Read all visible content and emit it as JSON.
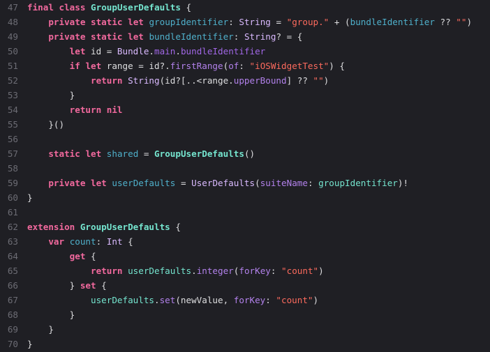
{
  "editor": {
    "colors": {
      "background": "#1f1f24",
      "line_number": "#6c6c74",
      "keyword": "#f2699e",
      "type": "#dabaff",
      "class_name": "#75e5cf",
      "property": "#a167e6",
      "variable": "#4fb0cb",
      "string": "#fc6a5d",
      "plain": "#dedee0"
    },
    "lines": [
      {
        "num": "47",
        "tokens": [
          [
            "final",
            "kw"
          ],
          [
            " ",
            "plain"
          ],
          [
            "class",
            "kw"
          ],
          [
            " ",
            "plain"
          ],
          [
            "GroupUserDefaults",
            "cls"
          ],
          [
            " {",
            "plain"
          ]
        ]
      },
      {
        "num": "48",
        "tokens": [
          [
            "    ",
            "plain"
          ],
          [
            "private",
            "kw"
          ],
          [
            " ",
            "plain"
          ],
          [
            "static",
            "kw"
          ],
          [
            " ",
            "plain"
          ],
          [
            "let",
            "kw"
          ],
          [
            " ",
            "plain"
          ],
          [
            "groupIdentifier",
            "var"
          ],
          [
            ": ",
            "plain"
          ],
          [
            "String",
            "type"
          ],
          [
            " = ",
            "plain"
          ],
          [
            "\"group.\"",
            "str"
          ],
          [
            " + (",
            "plain"
          ],
          [
            "bundleIdentifier",
            "var"
          ],
          [
            " ?? ",
            "plain"
          ],
          [
            "\"\"",
            "str"
          ],
          [
            ")",
            "plain"
          ]
        ]
      },
      {
        "num": "49",
        "tokens": [
          [
            "    ",
            "plain"
          ],
          [
            "private",
            "kw"
          ],
          [
            " ",
            "plain"
          ],
          [
            "static",
            "kw"
          ],
          [
            " ",
            "plain"
          ],
          [
            "let",
            "kw"
          ],
          [
            " ",
            "plain"
          ],
          [
            "bundleIdentifier",
            "var"
          ],
          [
            ": ",
            "plain"
          ],
          [
            "String",
            "type"
          ],
          [
            "? = {",
            "plain"
          ]
        ]
      },
      {
        "num": "50",
        "tokens": [
          [
            "        ",
            "plain"
          ],
          [
            "let",
            "kw"
          ],
          [
            " id = ",
            "plain"
          ],
          [
            "Bundle",
            "type"
          ],
          [
            ".",
            "plain"
          ],
          [
            "main",
            "prop"
          ],
          [
            ".",
            "plain"
          ],
          [
            "bundleIdentifier",
            "prop"
          ]
        ]
      },
      {
        "num": "51",
        "tokens": [
          [
            "        ",
            "plain"
          ],
          [
            "if",
            "kw"
          ],
          [
            " ",
            "plain"
          ],
          [
            "let",
            "kw"
          ],
          [
            " range = id?.",
            "plain"
          ],
          [
            "firstRange",
            "lib"
          ],
          [
            "(",
            "plain"
          ],
          [
            "of",
            "lib"
          ],
          [
            ": ",
            "plain"
          ],
          [
            "\"iOSWidgetTest\"",
            "str"
          ],
          [
            ") {",
            "plain"
          ]
        ]
      },
      {
        "num": "52",
        "tokens": [
          [
            "            ",
            "plain"
          ],
          [
            "return",
            "kw"
          ],
          [
            " ",
            "plain"
          ],
          [
            "String",
            "type"
          ],
          [
            "(id?[..<range.",
            "plain"
          ],
          [
            "upperBound",
            "lib"
          ],
          [
            "] ?? ",
            "plain"
          ],
          [
            "\"\"",
            "str"
          ],
          [
            ")",
            "plain"
          ]
        ]
      },
      {
        "num": "53",
        "tokens": [
          [
            "        }",
            "plain"
          ]
        ]
      },
      {
        "num": "54",
        "tokens": [
          [
            "        ",
            "plain"
          ],
          [
            "return",
            "kw"
          ],
          [
            " ",
            "plain"
          ],
          [
            "nil",
            "kw"
          ]
        ]
      },
      {
        "num": "55",
        "tokens": [
          [
            "    }()",
            "plain"
          ]
        ]
      },
      {
        "num": "56",
        "tokens": []
      },
      {
        "num": "57",
        "tokens": [
          [
            "    ",
            "plain"
          ],
          [
            "static",
            "kw"
          ],
          [
            " ",
            "plain"
          ],
          [
            "let",
            "kw"
          ],
          [
            " ",
            "plain"
          ],
          [
            "shared",
            "var"
          ],
          [
            " = ",
            "plain"
          ],
          [
            "GroupUserDefaults",
            "cls"
          ],
          [
            "()",
            "plain"
          ]
        ]
      },
      {
        "num": "58",
        "tokens": []
      },
      {
        "num": "59",
        "tokens": [
          [
            "    ",
            "plain"
          ],
          [
            "private",
            "kw"
          ],
          [
            " ",
            "plain"
          ],
          [
            "let",
            "kw"
          ],
          [
            " ",
            "plain"
          ],
          [
            "userDefaults",
            "var"
          ],
          [
            " = ",
            "plain"
          ],
          [
            "UserDefaults",
            "type"
          ],
          [
            "(",
            "plain"
          ],
          [
            "suiteName",
            "lib"
          ],
          [
            ": ",
            "plain"
          ],
          [
            "groupIdentifier",
            "func"
          ],
          [
            ")!",
            "plain"
          ]
        ]
      },
      {
        "num": "60",
        "tokens": [
          [
            "}",
            "plain"
          ]
        ]
      },
      {
        "num": "61",
        "tokens": []
      },
      {
        "num": "62",
        "tokens": [
          [
            "extension",
            "kw"
          ],
          [
            " ",
            "plain"
          ],
          [
            "GroupUserDefaults",
            "cls"
          ],
          [
            " {",
            "plain"
          ]
        ]
      },
      {
        "num": "63",
        "tokens": [
          [
            "    ",
            "plain"
          ],
          [
            "var",
            "kw"
          ],
          [
            " ",
            "plain"
          ],
          [
            "count",
            "var"
          ],
          [
            ": ",
            "plain"
          ],
          [
            "Int",
            "type"
          ],
          [
            " {",
            "plain"
          ]
        ]
      },
      {
        "num": "64",
        "tokens": [
          [
            "        ",
            "plain"
          ],
          [
            "get",
            "kw"
          ],
          [
            " {",
            "plain"
          ]
        ]
      },
      {
        "num": "65",
        "tokens": [
          [
            "            ",
            "plain"
          ],
          [
            "return",
            "kw"
          ],
          [
            " ",
            "plain"
          ],
          [
            "userDefaults",
            "func"
          ],
          [
            ".",
            "plain"
          ],
          [
            "integer",
            "lib"
          ],
          [
            "(",
            "plain"
          ],
          [
            "forKey",
            "lib"
          ],
          [
            ": ",
            "plain"
          ],
          [
            "\"count\"",
            "str"
          ],
          [
            ")",
            "plain"
          ]
        ]
      },
      {
        "num": "66",
        "tokens": [
          [
            "        } ",
            "plain"
          ],
          [
            "set",
            "kw"
          ],
          [
            " {",
            "plain"
          ]
        ]
      },
      {
        "num": "67",
        "tokens": [
          [
            "            ",
            "plain"
          ],
          [
            "userDefaults",
            "func"
          ],
          [
            ".",
            "plain"
          ],
          [
            "set",
            "lib"
          ],
          [
            "(newValue, ",
            "plain"
          ],
          [
            "forKey",
            "lib"
          ],
          [
            ": ",
            "plain"
          ],
          [
            "\"count\"",
            "str"
          ],
          [
            ")",
            "plain"
          ]
        ]
      },
      {
        "num": "68",
        "tokens": [
          [
            "        }",
            "plain"
          ]
        ]
      },
      {
        "num": "69",
        "tokens": [
          [
            "    }",
            "plain"
          ]
        ]
      },
      {
        "num": "70",
        "tokens": [
          [
            "}",
            "plain"
          ]
        ]
      }
    ]
  }
}
